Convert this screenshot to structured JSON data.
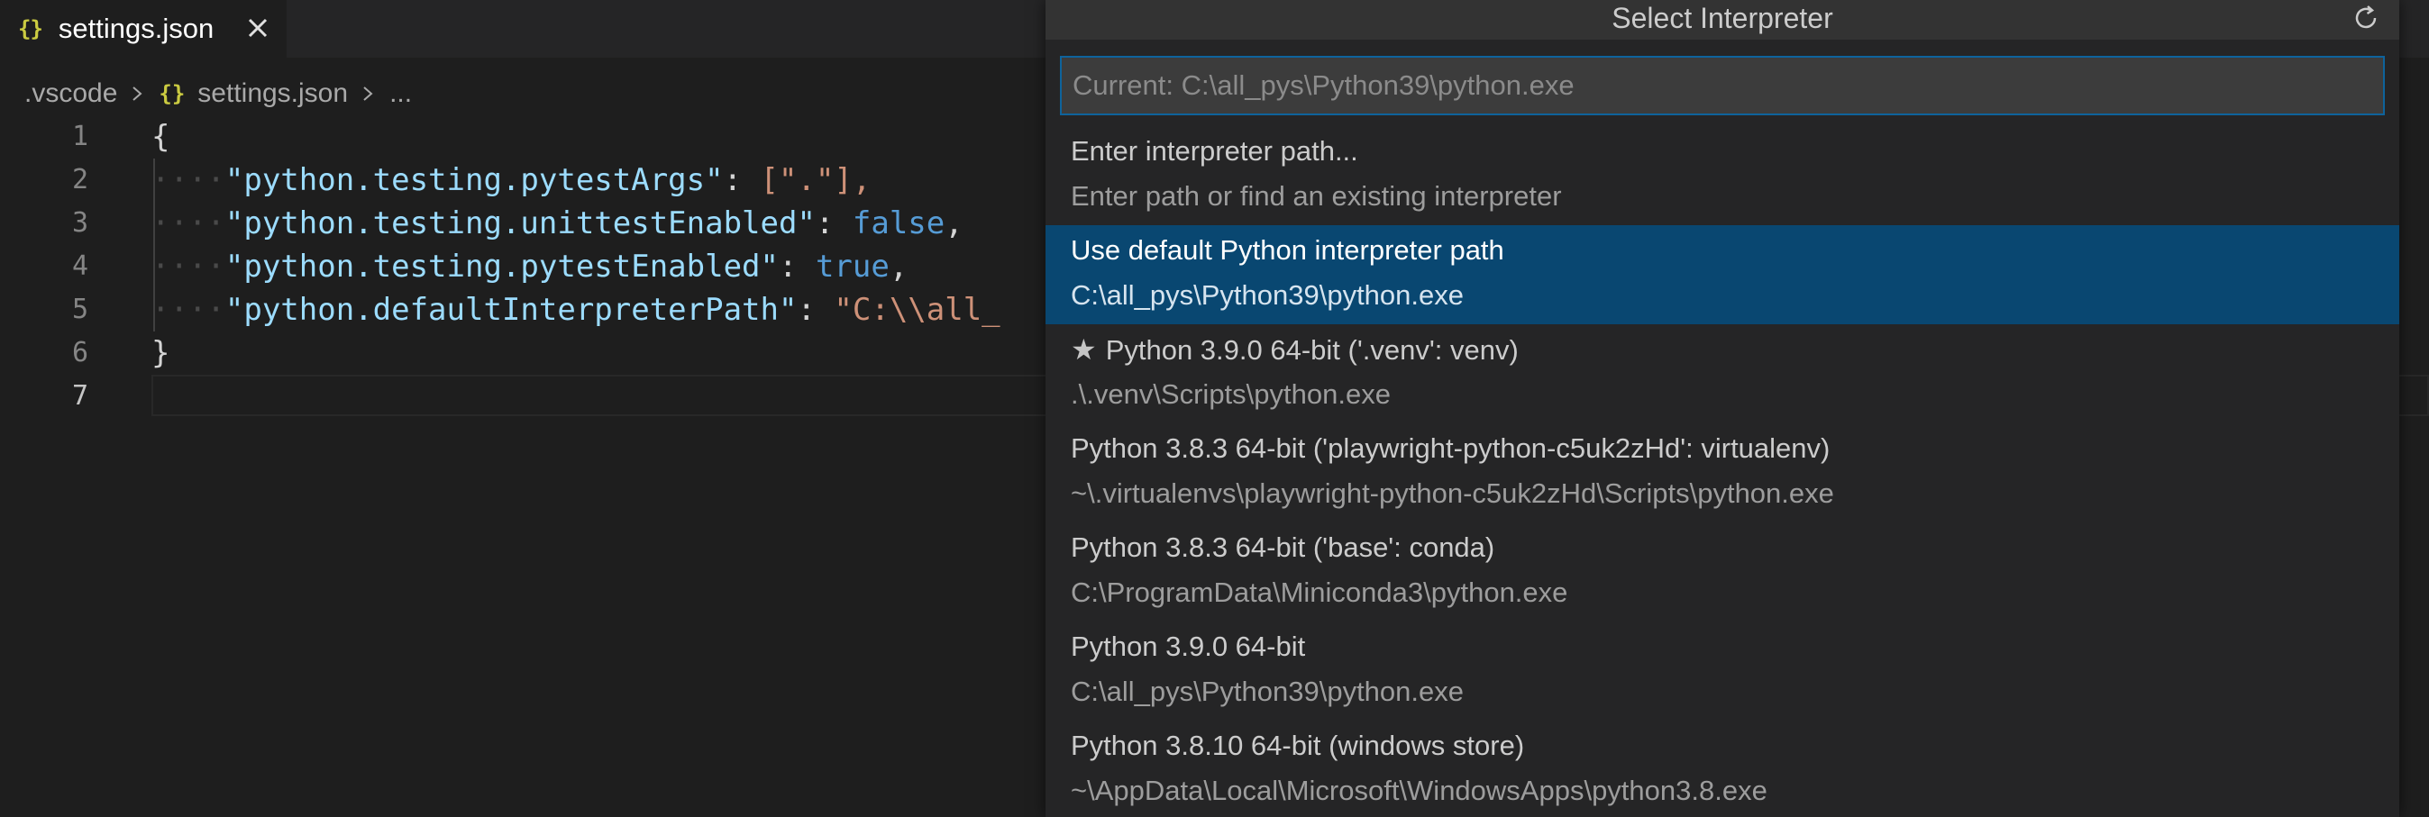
{
  "tab": {
    "icon": "json-braces-icon",
    "icon_glyph": "{}",
    "label": "settings.json"
  },
  "breadcrumb": {
    "folder": ".vscode",
    "file": "settings.json",
    "more": "..."
  },
  "editor": {
    "line_numbers": [
      "1",
      "2",
      "3",
      "4",
      "5",
      "6",
      "7"
    ],
    "lines": {
      "l1_open": "{",
      "l2_key": "\"python.testing.pytestArgs\"",
      "l2_value": "[\".\"],",
      "l3_key": "\"python.testing.unittestEnabled\"",
      "l3_value": "false",
      "l4_key": "\"python.testing.pytestEnabled\"",
      "l4_value": "true",
      "l5_key": "\"python.defaultInterpreterPath\"",
      "l5_value": "\"C:\\\\all_",
      "l6_close": "}"
    }
  },
  "quick_pick": {
    "title": "Select Interpreter",
    "input_placeholder": "Current: C:\\all_pys\\Python39\\python.exe",
    "items": [
      {
        "label": "Enter interpreter path...",
        "description": "Enter path or find an existing interpreter"
      },
      {
        "label": "Use default Python interpreter path",
        "description": "C:\\all_pys\\Python39\\python.exe",
        "selected": true
      },
      {
        "label": "Python 3.9.0 64-bit ('.venv': venv)",
        "description": ".\\.venv\\Scripts\\python.exe",
        "icon": "star-icon"
      },
      {
        "label": "Python 3.8.3 64-bit ('playwright-python-c5uk2zHd': virtualenv)",
        "description": "~\\.virtualenvs\\playwright-python-c5uk2zHd\\Scripts\\python.exe"
      },
      {
        "label": "Python 3.8.3 64-bit ('base': conda)",
        "description": "C:\\ProgramData\\Miniconda3\\python.exe"
      },
      {
        "label": "Python 3.9.0 64-bit",
        "description": "C:\\all_pys\\Python39\\python.exe"
      },
      {
        "label": "Python 3.8.10 64-bit (windows store)",
        "description": "~\\AppData\\Local\\Microsoft\\WindowsApps\\python3.8.exe"
      }
    ]
  },
  "colors": {
    "editor_background": "#1e1e1e",
    "selection_background": "#094771",
    "input_border": "#0e639c",
    "json_key": "#9cdcfe",
    "json_string": "#ce9178",
    "json_keyword": "#569cd6",
    "json_icon": "#cbcb41"
  }
}
